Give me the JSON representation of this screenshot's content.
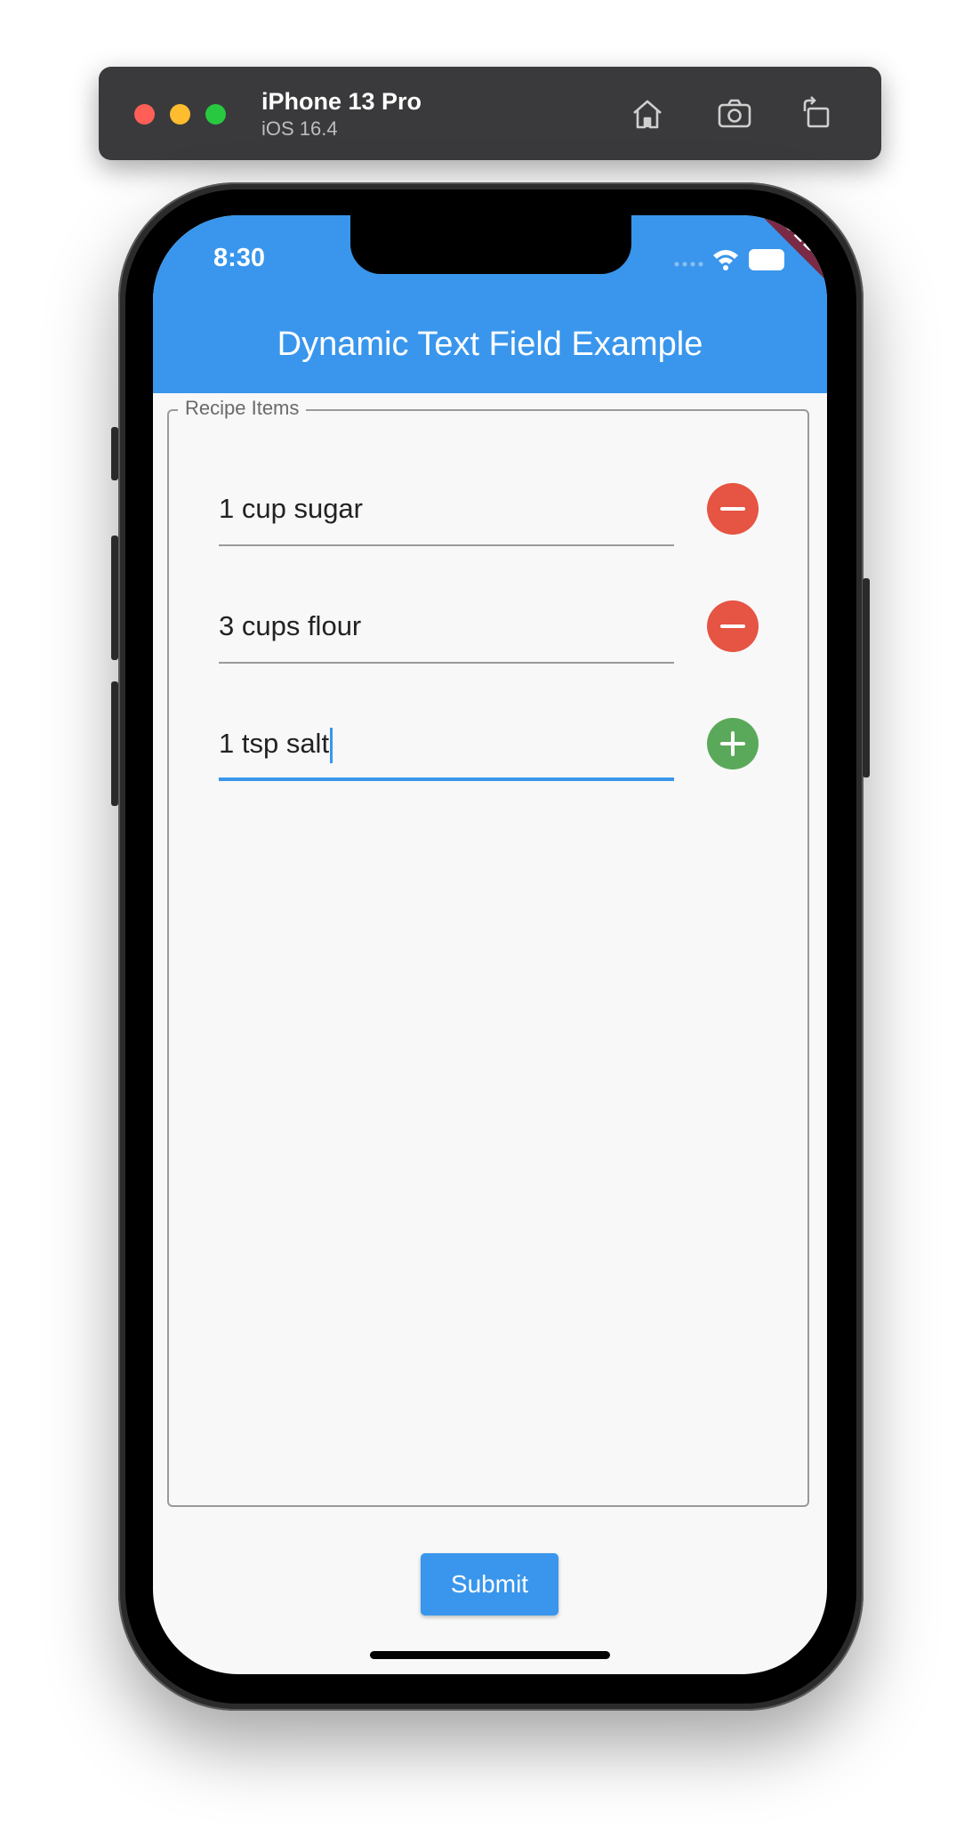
{
  "simulator": {
    "device_name": "iPhone 13 Pro",
    "os_version": "iOS 16.4",
    "icons": [
      "home-icon",
      "screenshot-icon",
      "rotate-icon"
    ]
  },
  "status_bar": {
    "time": "8:30",
    "debug_banner": "DEBUG"
  },
  "app_bar": {
    "title": "Dynamic Text Field Example",
    "color": "#3996ec"
  },
  "form": {
    "legend": "Recipe Items",
    "items": [
      {
        "value": "1 cup sugar",
        "action": "remove",
        "action_color": "#e65443",
        "focused": false
      },
      {
        "value": "3 cups flour",
        "action": "remove",
        "action_color": "#e65443",
        "focused": false
      },
      {
        "value": "1 tsp salt",
        "action": "add",
        "action_color": "#5aa95a",
        "focused": true
      }
    ],
    "submit_label": "Submit"
  }
}
